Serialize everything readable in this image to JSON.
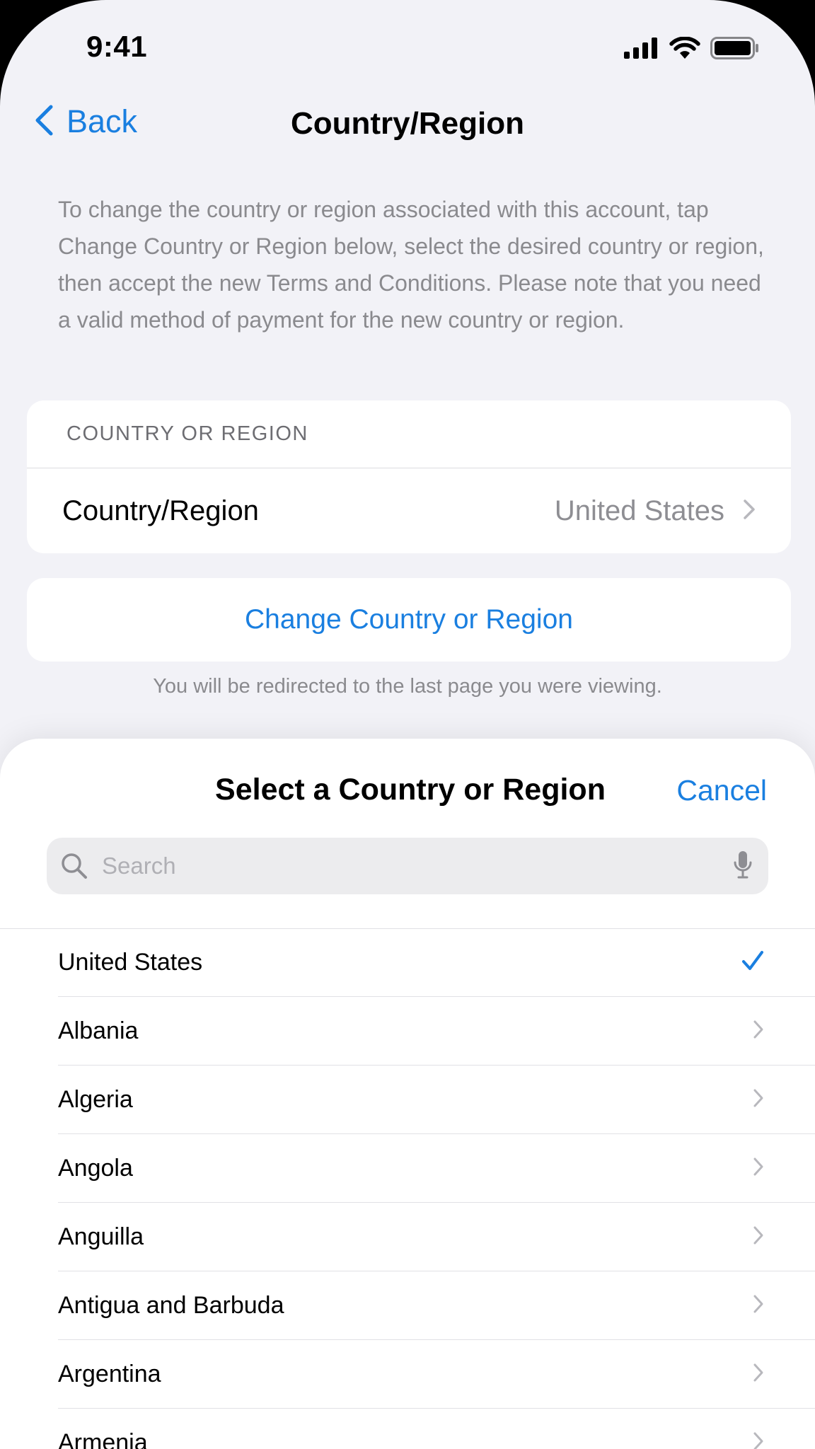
{
  "status_bar": {
    "time": "9:41"
  },
  "nav": {
    "back_label": "Back",
    "title": "Country/Region"
  },
  "intro_text": "To change the country or region associated with this account, tap Change Country or Region below, select the desired country or region, then accept the new Terms and Conditions. Please note that you need a valid method of payment for the new country or region.",
  "country_section": {
    "header": "COUNTRY OR REGION",
    "row_label": "Country/Region",
    "row_value": "United States"
  },
  "change_button_label": "Change Country or Region",
  "footnote": "You will be redirected to the last page you were viewing.",
  "sheet": {
    "title": "Select a Country or Region",
    "cancel_label": "Cancel",
    "search_placeholder": "Search",
    "selected": "United States",
    "items": [
      "United States",
      "Albania",
      "Algeria",
      "Angola",
      "Anguilla",
      "Antigua and Barbuda",
      "Argentina",
      "Armenia"
    ]
  },
  "colors": {
    "accent": "#1a7fe0",
    "background": "#f2f2f7",
    "secondary_text": "#8a8a8e"
  },
  "icons": [
    "signal-icon",
    "wifi-icon",
    "battery-icon",
    "chevron-left-icon",
    "chevron-right-icon",
    "search-icon",
    "microphone-icon",
    "checkmark-icon"
  ]
}
